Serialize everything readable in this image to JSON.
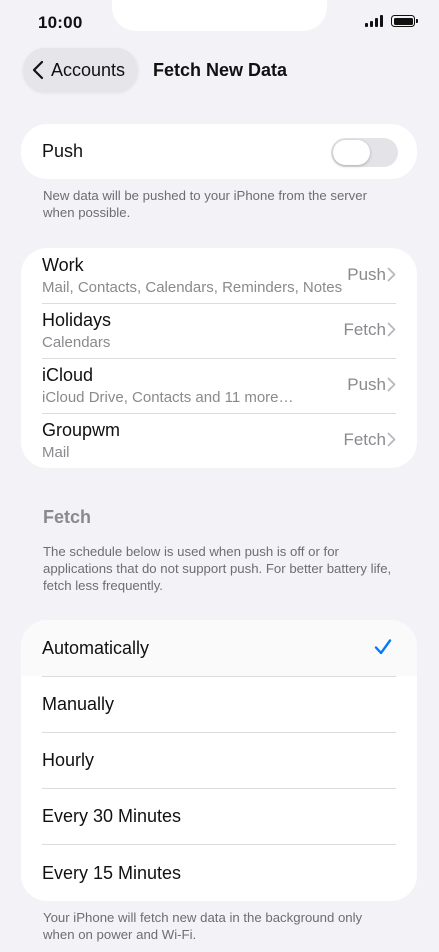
{
  "status_bar": {
    "time": "10:00"
  },
  "nav": {
    "back_label": "Accounts",
    "title": "Fetch New Data"
  },
  "push": {
    "label": "Push",
    "enabled": false,
    "footnote": "New data will be pushed to your iPhone from the server when possible."
  },
  "accounts": [
    {
      "name": "Work",
      "detail": "Mail, Contacts, Calendars, Reminders, Notes",
      "value": "Push"
    },
    {
      "name": "Holidays",
      "detail": "Calendars",
      "value": "Fetch"
    },
    {
      "name": "iCloud",
      "detail": "iCloud Drive, Contacts and 11 more…",
      "value": "Push"
    },
    {
      "name": "Groupwm",
      "detail": "Mail",
      "value": "Fetch"
    }
  ],
  "fetch": {
    "header": "Fetch",
    "description": "The schedule below is used when push is off or for applications that do not support push. For better battery life, fetch less frequently.",
    "options": [
      "Automatically",
      "Manually",
      "Hourly",
      "Every 30 Minutes",
      "Every 15 Minutes"
    ],
    "selected": "Automatically",
    "footnote": "Your iPhone will fetch new data in the background only when on power and Wi-Fi."
  },
  "colors": {
    "accent": "#007aff",
    "background": "#f2f2f7",
    "secondary_text": "#8a8a8e"
  },
  "icons": {
    "back": "chevron-left-icon",
    "disclosure": "chevron-right-icon",
    "selected": "checkmark-icon"
  }
}
